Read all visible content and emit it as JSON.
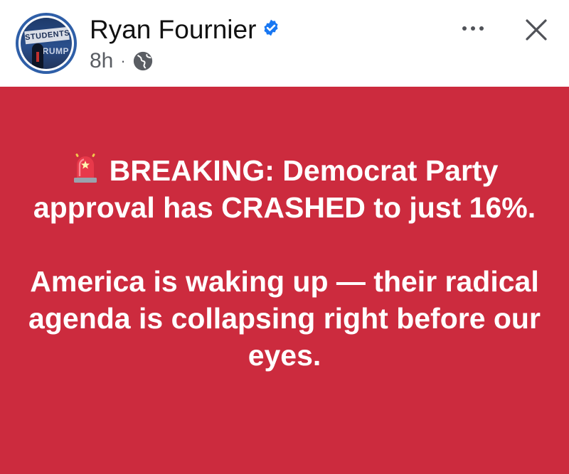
{
  "author": {
    "name": "Ryan Fournier",
    "verified": true,
    "avatar": {
      "banner_text": "STUDENTS",
      "sub_text": "TRUMP"
    }
  },
  "meta": {
    "time": "8h",
    "separator": "·",
    "audience_icon": "globe-icon"
  },
  "actions": {
    "more_icon": "more-horizontal-icon",
    "close_icon": "close-icon"
  },
  "post": {
    "background_color": "#cc2b3e",
    "text_color": "#ffffff",
    "leading_icon": "siren-icon",
    "paragraph1": "BREAKING: Democrat Party approval has CRASHED to just 16%.",
    "paragraph2": "America is waking up — their radical agenda is collapsing right before our eyes."
  },
  "colors": {
    "verified_badge": "#1877f2",
    "avatar_ring": "#2f5fa8"
  }
}
